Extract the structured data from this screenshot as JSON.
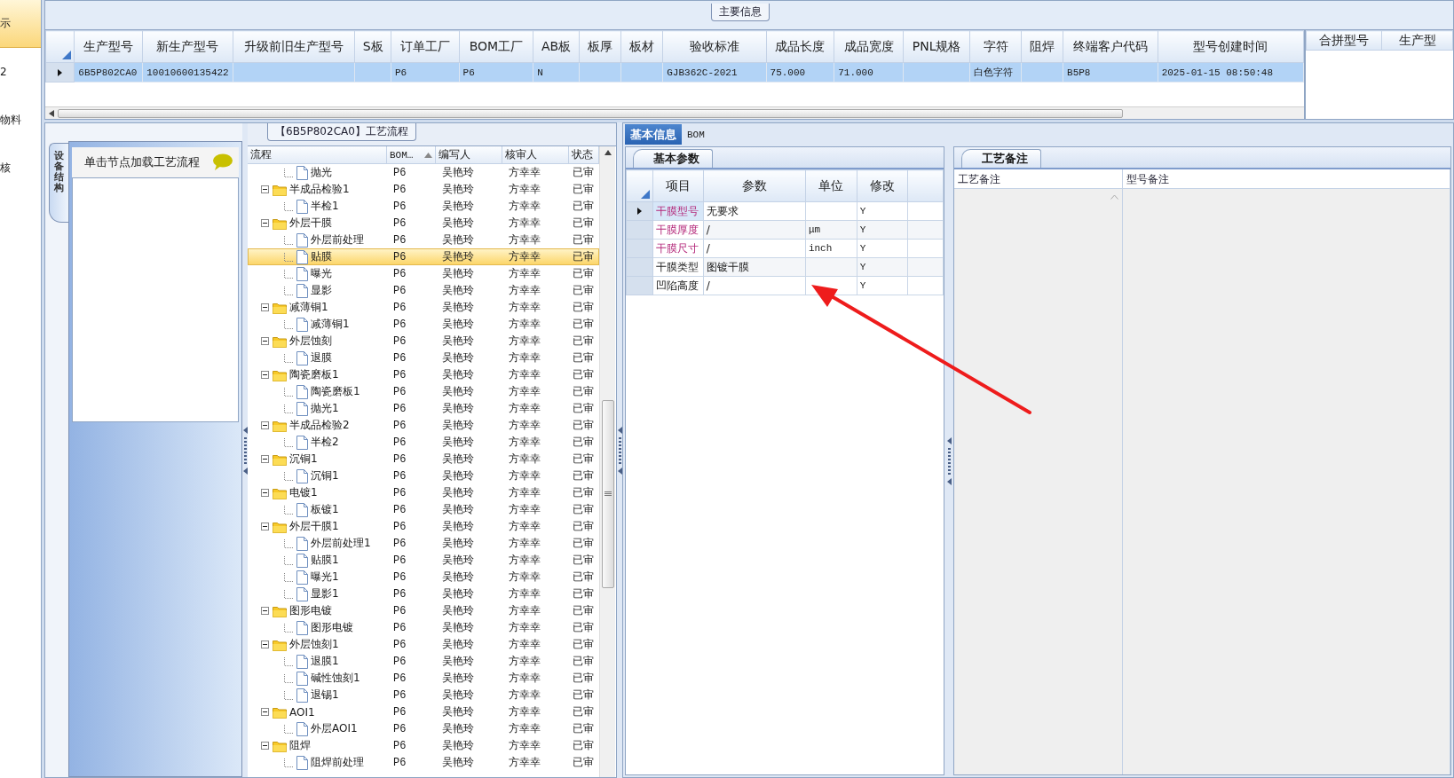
{
  "sidebar": {
    "items": [
      {
        "label": "示",
        "selected": true
      },
      {
        "label": "2",
        "selected": false
      },
      {
        "label": "物料",
        "selected": false
      },
      {
        "label": "核",
        "selected": false
      }
    ]
  },
  "main_info": {
    "title": "主要信息",
    "table": {
      "columns": [
        "生产型号",
        "新生产型号",
        "升级前旧生产型号",
        "S板",
        "订单工厂",
        "BOM工厂",
        "AB板",
        "板厚",
        "板材",
        "验收标准",
        "成品长度",
        "成品宽度",
        "PNL规格",
        "字符",
        "阻焊",
        "终端客户代码",
        "型号创建时间"
      ],
      "rows": [
        {
          "selected": true,
          "cells": [
            "6B5P802CA0",
            "10010600135422",
            null,
            null,
            "P6",
            "P6",
            "N",
            null,
            null,
            "GJB362C-2021",
            "75.000",
            "71.000",
            null,
            "白色字符",
            null,
            "B5P8",
            "2025-01-15 08:50:48"
          ]
        }
      ]
    },
    "side_table": {
      "columns": [
        "合拼型号",
        "生产型"
      ]
    }
  },
  "process_panel": {
    "side_tab": "设备结构",
    "hint": "单击节点加载工艺流程",
    "title": "【6B5P802CA0】工艺流程",
    "columns": [
      "流程",
      "BOM…",
      "编写人",
      "核审人",
      "状态"
    ],
    "tree": [
      {
        "children": [
          {
            "label": "抛光",
            "bom": "P6",
            "writer": "吴艳玲",
            "reviewer": "方幸幸",
            "status": "已审",
            "selected": false
          }
        ]
      },
      {
        "label": "半成品检验1",
        "bom": "P6",
        "writer": "吴艳玲",
        "reviewer": "方幸幸",
        "status": "已审",
        "selected": false,
        "expanded": true,
        "children": [
          {
            "label": "半检1",
            "bom": "P6",
            "writer": "吴艳玲",
            "reviewer": "方幸幸",
            "status": "已审",
            "selected": false
          }
        ]
      },
      {
        "label": "外层干膜",
        "bom": "P6",
        "writer": "吴艳玲",
        "reviewer": "方幸幸",
        "status": "已审",
        "selected": false,
        "expanded": true,
        "children": [
          {
            "label": "外层前处理",
            "bom": "P6",
            "writer": "吴艳玲",
            "reviewer": "方幸幸",
            "status": "已审",
            "selected": false
          },
          {
            "label": "贴膜",
            "bom": "P6",
            "writer": "吴艳玲",
            "reviewer": "方幸幸",
            "status": "已审",
            "selected": true
          },
          {
            "label": "曝光",
            "bom": "P6",
            "writer": "吴艳玲",
            "reviewer": "方幸幸",
            "status": "已审",
            "selected": false
          },
          {
            "label": "显影",
            "bom": "P6",
            "writer": "吴艳玲",
            "reviewer": "方幸幸",
            "status": "已审",
            "selected": false
          }
        ]
      },
      {
        "label": "减薄铜1",
        "bom": "P6",
        "writer": "吴艳玲",
        "reviewer": "方幸幸",
        "status": "已审",
        "selected": false,
        "expanded": true,
        "children": [
          {
            "label": "减薄铜1",
            "bom": "P6",
            "writer": "吴艳玲",
            "reviewer": "方幸幸",
            "status": "已审",
            "selected": false
          }
        ]
      },
      {
        "label": "外层蚀刻",
        "bom": "P6",
        "writer": "吴艳玲",
        "reviewer": "方幸幸",
        "status": "已审",
        "selected": false,
        "expanded": true,
        "children": [
          {
            "label": "退膜",
            "bom": "P6",
            "writer": "吴艳玲",
            "reviewer": "方幸幸",
            "status": "已审",
            "selected": false
          }
        ]
      },
      {
        "label": "陶瓷磨板1",
        "bom": "P6",
        "writer": "吴艳玲",
        "reviewer": "方幸幸",
        "status": "已审",
        "selected": false,
        "expanded": true,
        "children": [
          {
            "label": "陶瓷磨板1",
            "bom": "P6",
            "writer": "吴艳玲",
            "reviewer": "方幸幸",
            "status": "已审",
            "selected": false
          },
          {
            "label": "抛光1",
            "bom": "P6",
            "writer": "吴艳玲",
            "reviewer": "方幸幸",
            "status": "已审",
            "selected": false
          }
        ]
      },
      {
        "label": "半成品检验2",
        "bom": "P6",
        "writer": "吴艳玲",
        "reviewer": "方幸幸",
        "status": "已审",
        "selected": false,
        "expanded": true,
        "children": [
          {
            "label": "半检2",
            "bom": "P6",
            "writer": "吴艳玲",
            "reviewer": "方幸幸",
            "status": "已审",
            "selected": false
          }
        ]
      },
      {
        "label": "沉铜1",
        "bom": "P6",
        "writer": "吴艳玲",
        "reviewer": "方幸幸",
        "status": "已审",
        "selected": false,
        "expanded": true,
        "children": [
          {
            "label": "沉铜1",
            "bom": "P6",
            "writer": "吴艳玲",
            "reviewer": "方幸幸",
            "status": "已审",
            "selected": false
          }
        ]
      },
      {
        "label": "电镀1",
        "bom": "P6",
        "writer": "吴艳玲",
        "reviewer": "方幸幸",
        "status": "已审",
        "selected": false,
        "expanded": true,
        "children": [
          {
            "label": "板镀1",
            "bom": "P6",
            "writer": "吴艳玲",
            "reviewer": "方幸幸",
            "status": "已审",
            "selected": false
          }
        ]
      },
      {
        "label": "外层干膜1",
        "bom": "P6",
        "writer": "吴艳玲",
        "reviewer": "方幸幸",
        "status": "已审",
        "selected": false,
        "expanded": true,
        "children": [
          {
            "label": "外层前处理1",
            "bom": "P6",
            "writer": "吴艳玲",
            "reviewer": "方幸幸",
            "status": "已审",
            "selected": false
          },
          {
            "label": "贴膜1",
            "bom": "P6",
            "writer": "吴艳玲",
            "reviewer": "方幸幸",
            "status": "已审",
            "selected": false
          },
          {
            "label": "曝光1",
            "bom": "P6",
            "writer": "吴艳玲",
            "reviewer": "方幸幸",
            "status": "已审",
            "selected": false
          },
          {
            "label": "显影1",
            "bom": "P6",
            "writer": "吴艳玲",
            "reviewer": "方幸幸",
            "status": "已审",
            "selected": false
          }
        ]
      },
      {
        "label": "图形电镀",
        "bom": "P6",
        "writer": "吴艳玲",
        "reviewer": "方幸幸",
        "status": "已审",
        "selected": false,
        "expanded": true,
        "children": [
          {
            "label": "图形电镀",
            "bom": "P6",
            "writer": "吴艳玲",
            "reviewer": "方幸幸",
            "status": "已审",
            "selected": false
          }
        ]
      },
      {
        "label": "外层蚀刻1",
        "bom": "P6",
        "writer": "吴艳玲",
        "reviewer": "方幸幸",
        "status": "已审",
        "selected": false,
        "expanded": true,
        "children": [
          {
            "label": "退膜1",
            "bom": "P6",
            "writer": "吴艳玲",
            "reviewer": "方幸幸",
            "status": "已审",
            "selected": false
          },
          {
            "label": "碱性蚀刻1",
            "bom": "P6",
            "writer": "吴艳玲",
            "reviewer": "方幸幸",
            "status": "已审",
            "selected": false
          },
          {
            "label": "退锡1",
            "bom": "P6",
            "writer": "吴艳玲",
            "reviewer": "方幸幸",
            "status": "已审",
            "selected": false
          }
        ]
      },
      {
        "label": "AOI1",
        "bom": "P6",
        "writer": "吴艳玲",
        "reviewer": "方幸幸",
        "status": "已审",
        "selected": false,
        "expanded": true,
        "children": [
          {
            "label": "外层AOI1",
            "bom": "P6",
            "writer": "吴艳玲",
            "reviewer": "方幸幸",
            "status": "已审",
            "selected": false
          }
        ]
      },
      {
        "label": "阻焊",
        "bom": "P6",
        "writer": "吴艳玲",
        "reviewer": "方幸幸",
        "status": "已审",
        "selected": false,
        "expanded": true,
        "children": [
          {
            "label": "阻焊前处理",
            "bom": "P6",
            "writer": "吴艳玲",
            "reviewer": "方幸幸",
            "status": "已审",
            "selected": false
          }
        ]
      }
    ]
  },
  "detail": {
    "tabs": [
      {
        "label": "基本信息",
        "selected": true
      },
      {
        "label": "BOM",
        "selected": false
      }
    ],
    "params": {
      "tab": "基本参数",
      "columns": [
        "项目",
        "参数",
        "单位",
        "修改"
      ],
      "rows": [
        {
          "item": "干膜型号",
          "param": "无要求",
          "modify": "Y",
          "required": true,
          "selected": true
        },
        {
          "item": "干膜厚度",
          "param": "/",
          "unit": "μm",
          "modify": "Y",
          "required": true,
          "selected": false
        },
        {
          "item": "干膜尺寸",
          "param": "/",
          "unit": "inch",
          "modify": "Y",
          "required": true,
          "selected": false
        },
        {
          "item": "干膜类型",
          "param": "图镀干膜",
          "modify": "Y",
          "required": false,
          "selected": false
        },
        {
          "item": "凹陷高度",
          "param": "/",
          "modify": "Y",
          "required": false,
          "selected": false
        }
      ]
    },
    "notes": {
      "tab": "工艺备注",
      "columns": [
        "工艺备注",
        "型号备注"
      ]
    }
  },
  "annotation": {
    "kind": "arrow"
  }
}
